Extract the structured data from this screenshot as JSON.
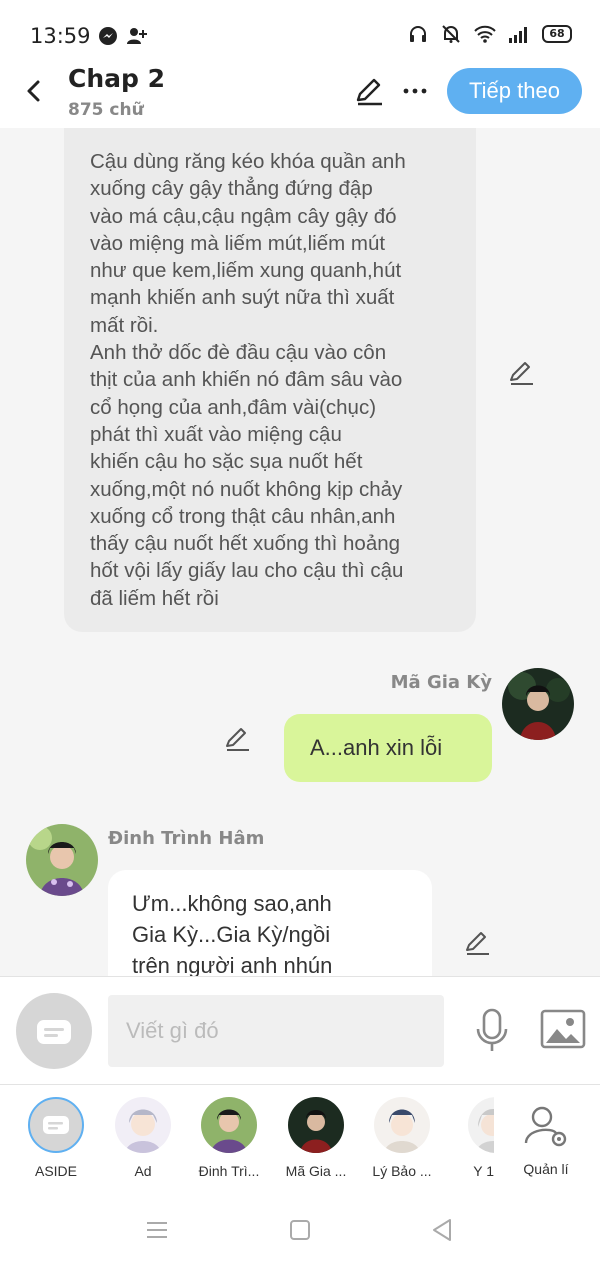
{
  "status": {
    "time": "13:59",
    "battery": "68"
  },
  "header": {
    "title": "Chap 2",
    "word_count": "875 chữ",
    "next_label": "Tiếp theo"
  },
  "messages": {
    "narration": "Cậu dùng răng kéo khóa quần anh\nxuống cây gậy thẳng đứng đập\nvào má cậu,cậu ngậm cây gậy đó\nvào miệng mà liếm mút,liếm mút\nnhư que kem,liếm xung quanh,hút\nmạnh khiến anh suýt nữa thì xuất\nmất rồi.\nAnh thở dốc đè đầu cậu vào côn\nthịt của anh khiến nó đâm sâu vào\ncổ họng của anh,đâm vài(chục)\nphát thì xuất vào miệng cậu\nkhiến cậu ho sặc sụa nuốt hết\nxuống,một nó nuốt không kịp chảy\nxuống cổ trong thật câu nhân,anh\nthấy cậu nuốt hết xuống thì hoảng\nhốt vội lấy giấy lau cho cậu thì cậu\nđã liếm hết rồi",
    "right_name": "Mã Gia Kỳ",
    "right_text": "A...anh xin lỗi",
    "left_name": "Đinh Trình Hâm",
    "left_text": "Ưm...không sao,anh\nGia Kỳ...Gia Kỳ/ngồi\ntrên người anh nhún"
  },
  "input": {
    "placeholder": "Viết gì đó"
  },
  "characters": [
    {
      "label": "ASIDE"
    },
    {
      "label": "Ad"
    },
    {
      "label": "Đinh Trì..."
    },
    {
      "label": "Mã Gia ..."
    },
    {
      "label": "Lý Bảo ..."
    },
    {
      "label": "Y 1"
    },
    {
      "label": "Quản lí"
    }
  ],
  "colors": {
    "accent": "#5fb0f1",
    "green_bubble": "#d9f59a",
    "gray_bubble": "#ebebeb"
  }
}
